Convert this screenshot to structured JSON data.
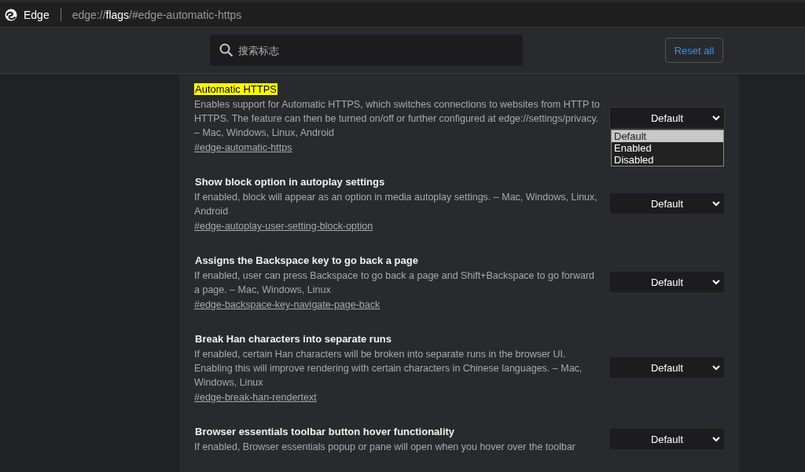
{
  "address_bar": {
    "browser_name": "Edge",
    "url": "edge://**flags**/#edge-automatic-https"
  },
  "search": {
    "placeholder": "搜索标志"
  },
  "reset_button": "Reset all",
  "flags": [
    {
      "title": "Automatic HTTPS",
      "highlighted": true,
      "description": "Enables support for Automatic HTTPS, which switches connections to websites from HTTP to HTTPS. The feature can then be turned on/off or further configured at edge://settings/privacy. – Mac, Windows, Linux, Android",
      "link": "#edge-automatic-https",
      "value": "Default",
      "expanded": true,
      "options": [
        {
          "label": "Default",
          "selected": true
        },
        {
          "label": "Enabled",
          "selected": false
        },
        {
          "label": "Disabled",
          "selected": false
        }
      ]
    },
    {
      "title": "Show block option in autoplay settings",
      "highlighted": false,
      "description": "If enabled, block will appear as an option in media autoplay settings. – Mac, Windows, Linux, Android",
      "link": "#edge-autoplay-user-setting-block-option",
      "value": "Default"
    },
    {
      "title": "Assigns the Backspace key to go back a page",
      "highlighted": false,
      "description": "If enabled, user can press Backspace to go back a page and Shift+Backspace to go forward a page. – Mac, Windows, Linux",
      "link": "#edge-backspace-key-navigate-page-back",
      "value": "Default"
    },
    {
      "title": "Break Han characters into separate runs",
      "highlighted": false,
      "description": "If enabled, certain Han characters will be broken into separate runs in the browser UI. Enabling this will improve rendering with certain characters in Chinese languages. – Mac, Windows, Linux",
      "link": "#edge-break-han-rendertext",
      "value": "Default"
    },
    {
      "title": "Browser essentials toolbar button hover functionality",
      "highlighted": false,
      "description": "If enabled, Browser essentials popup or pane will open when you hover over the toolbar",
      "value": "Default"
    }
  ]
}
